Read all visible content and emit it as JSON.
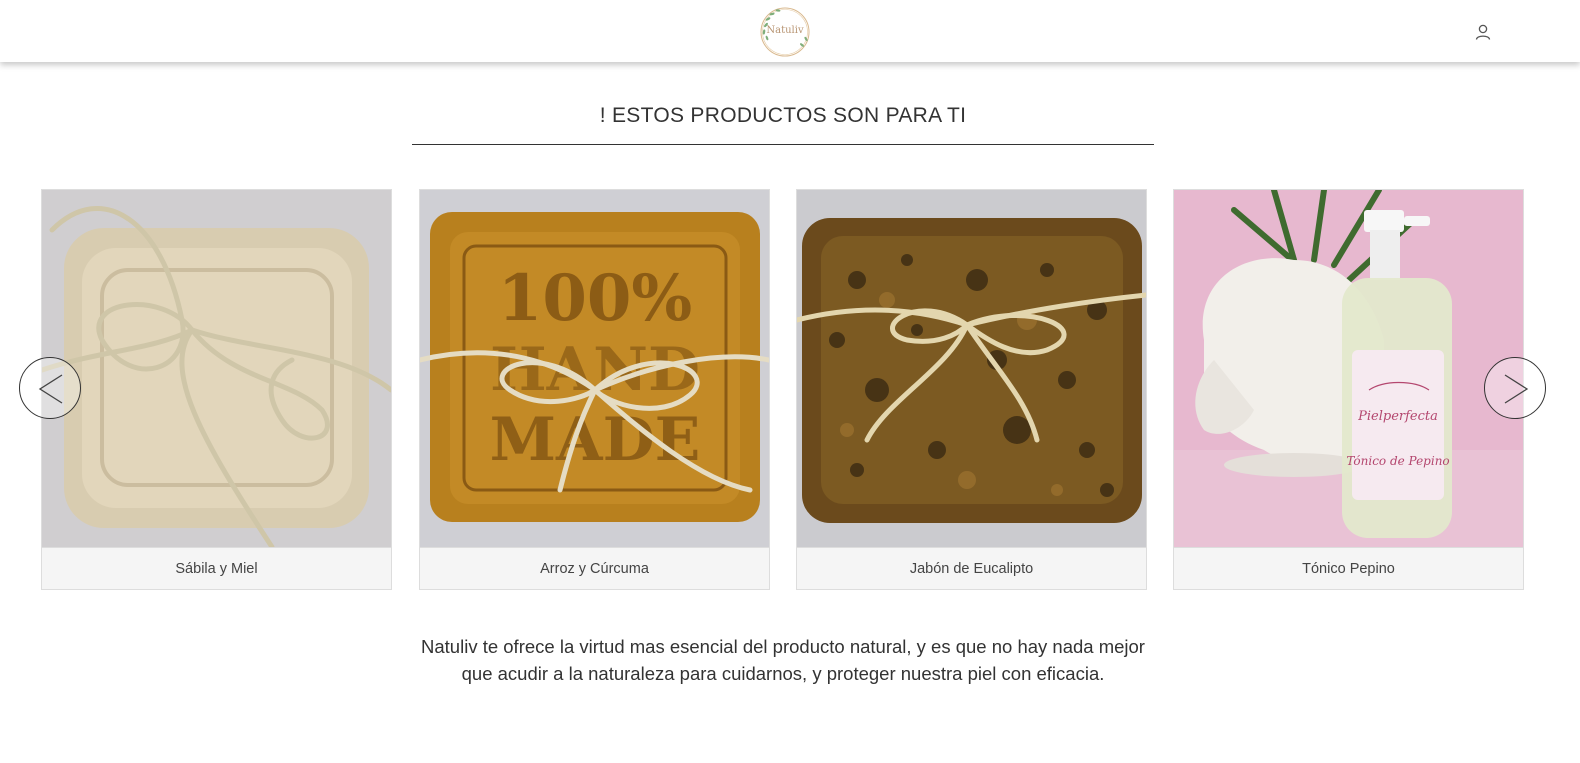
{
  "header": {
    "logo_text": "Natuliv",
    "icons": {
      "account": "user-icon"
    }
  },
  "section": {
    "title": "! ESTOS PRODUCTOS SON PARA TI"
  },
  "carousel": {
    "prev_icon": "chevron-left-icon",
    "next_icon": "chevron-right-icon",
    "products": [
      {
        "name": "Sábila y Miel"
      },
      {
        "name": "Arroz y Cúrcuma"
      },
      {
        "name": "Jabón de Eucalipto"
      },
      {
        "name": "Tónico Pepino"
      }
    ]
  },
  "intro": {
    "text": "Natuliv te ofrece la virtud mas esencial del producto natural, y es que no hay nada mejor que acudir a la naturaleza para cuidarnos, y proteger nuestra piel con eficacia."
  },
  "colors": {
    "accent": "#b89573",
    "leaf": "#7fae7b",
    "caption_bg": "#f5f5f5",
    "text": "#333333"
  }
}
